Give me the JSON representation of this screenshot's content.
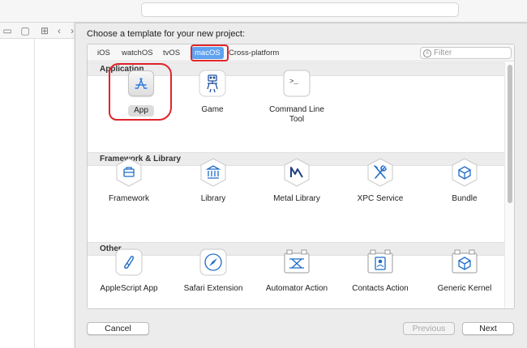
{
  "dialog": {
    "prompt": "Choose a template for your new project:"
  },
  "tabs": [
    {
      "label": "iOS",
      "selected": false
    },
    {
      "label": "watchOS",
      "selected": false
    },
    {
      "label": "tvOS",
      "selected": false
    },
    {
      "label": "macOS",
      "selected": true
    },
    {
      "label": "Cross-platform",
      "selected": false
    }
  ],
  "filter": {
    "placeholder": "Filter"
  },
  "sections": [
    {
      "title": "Application",
      "templates": [
        {
          "label": "App",
          "icon": "app-store-icon",
          "selected": true
        },
        {
          "label": "Game",
          "icon": "game-robot-icon",
          "selected": false
        },
        {
          "label": "Command Line Tool",
          "icon": "terminal-icon",
          "selected": false
        }
      ]
    },
    {
      "title": "Framework & Library",
      "templates": [
        {
          "label": "Framework",
          "icon": "toolbox-icon"
        },
        {
          "label": "Library",
          "icon": "columns-icon"
        },
        {
          "label": "Metal Library",
          "icon": "metal-icon"
        },
        {
          "label": "XPC Service",
          "icon": "wrench-screwdriver-icon"
        },
        {
          "label": "Bundle",
          "icon": "cube-icon"
        }
      ]
    },
    {
      "title": "Other",
      "templates": [
        {
          "label": "AppleScript App",
          "icon": "script-icon"
        },
        {
          "label": "Safari Extension",
          "icon": "compass-icon"
        },
        {
          "label": "Automator Action",
          "icon": "automator-icon"
        },
        {
          "label": "Contacts Action",
          "icon": "contacts-icon"
        },
        {
          "label": "Generic Kernel",
          "icon": "kernel-cube-icon"
        }
      ]
    }
  ],
  "buttons": {
    "cancel": "Cancel",
    "previous": "Previous",
    "next": "Next"
  },
  "colors": {
    "accent": "#5ea2f0",
    "annotation": "#e0242a"
  }
}
